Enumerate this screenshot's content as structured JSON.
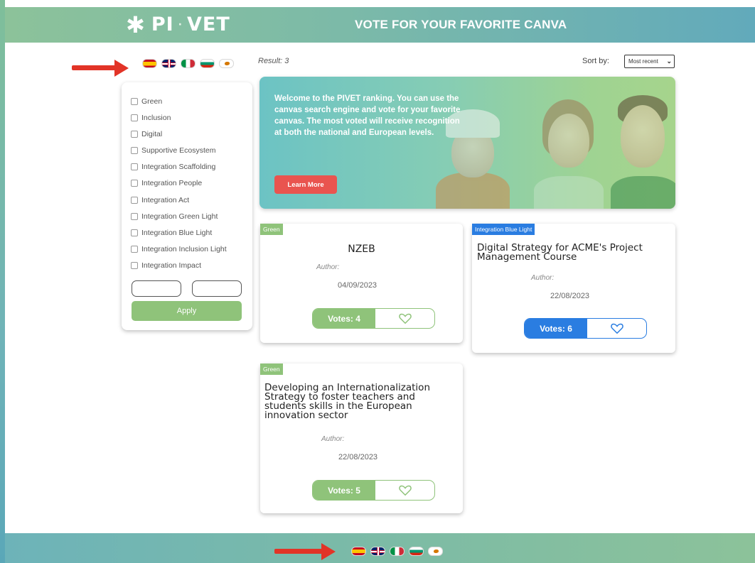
{
  "header": {
    "logo_text": "PI",
    "logo_text_2": "VET",
    "title": "VOTE FOR YOUR FAVORITE CANVA"
  },
  "languages": [
    "es",
    "gb",
    "it",
    "bg",
    "cy"
  ],
  "toolbar": {
    "result": "Result: 3",
    "sort_label": "Sort by:",
    "sort_value": "Most recent"
  },
  "filters": {
    "items": [
      "Green",
      "Inclusion",
      "Digital",
      "Supportive Ecosystem",
      "Integration Scaffolding",
      "Integration People",
      "Integration Act",
      "Integration Green Light",
      "Integration Blue Light",
      "Integration Inclusion Light",
      "Integration Impact"
    ],
    "apply_label": "Apply"
  },
  "hero": {
    "text": "Welcome to the PIVET ranking. You can use the canvas search engine and vote for your favorite canvas. The most voted will receive recognition at both the national and European levels.",
    "button_label": "Learn More"
  },
  "cards": [
    {
      "tag": "Green",
      "title": "NZEB",
      "author_label": "Author:",
      "date": "04/09/2023",
      "votes_label": "Votes: 4"
    },
    {
      "tag": "Integration Blue Light",
      "title_lines": [
        "Digital Strategy for ACME's Project",
        "Management Course"
      ],
      "author_label": "Author:",
      "date": "22/08/2023",
      "votes_label": "Votes: 6"
    },
    {
      "tag": "Green",
      "title_lines": [
        "Developing an Internationalization",
        "Strategy to foster teachers and",
        "students skills in the European",
        "innovation sector"
      ],
      "author_label": "Author:",
      "date": "22/08/2023",
      "votes_label": "Votes: 5"
    }
  ],
  "colors": {
    "green": "#8fc37a",
    "blue": "#2a7de1",
    "red_button": "#e9544f",
    "arrow": "#e23427"
  }
}
